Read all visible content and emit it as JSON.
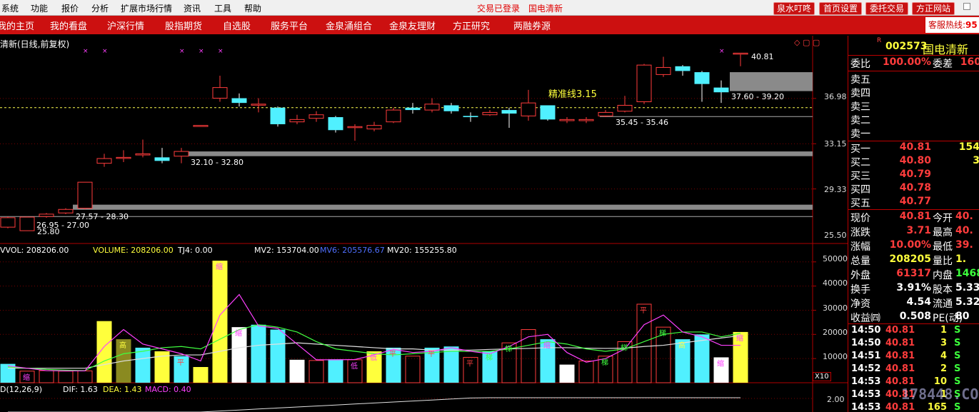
{
  "menubar": {
    "items": [
      "系统",
      "功能",
      "报价",
      "分析",
      "扩展市场行情",
      "资讯",
      "工具",
      "帮助"
    ],
    "status_login": "交易已登录",
    "status_stock": "国电清新",
    "buttons": [
      "泉水叮咚",
      "首页设置",
      "委托交易",
      "方正网站"
    ]
  },
  "navbar": {
    "items": [
      "我的主页",
      "我的看盘",
      "沪深行情",
      "股指期货",
      "自选股",
      "服务平台",
      "金泉涌组合",
      "金泉友理财",
      "方正研究",
      "两融券源"
    ],
    "hotline_label": "客服热线:",
    "hotline_number": "95"
  },
  "kline": {
    "title": "清新(日线,前复权)",
    "price_axis": [
      "36.98",
      "33.15",
      "29.33",
      "25.50"
    ],
    "benchmark_label": "精准线3.15",
    "high_label": "40.81",
    "low_label": "25.80",
    "zones": [
      "37.60 - 39.20",
      "35.45 - 35.46",
      "32.10 - 32.80",
      "27.57 - 28.30",
      "26.95 - 27.00"
    ]
  },
  "volume": {
    "header": {
      "vol": "VVOL: 208206.00",
      "volume": "VOLUME: 208206.00",
      "tj4": "TJ4: 0.00",
      "mv2": "MV2: 153704.00",
      "mv6": "MV6: 205576.67",
      "mv20": "MV20: 155255.80"
    },
    "axis": [
      "50000",
      "40000",
      "30000",
      "20000",
      "10000"
    ],
    "unit": "X10",
    "marks": [
      "高",
      "缩",
      "高",
      "缩",
      "平",
      "缩",
      "低",
      "平",
      "低",
      "平",
      "平",
      "梯",
      "梯",
      "缩",
      "梯",
      "梯",
      "平",
      "梯",
      "高",
      "缩",
      "缩"
    ]
  },
  "macd": {
    "header": {
      "name": "D(12,26,9)",
      "dif": "DIF: 1.63",
      "dea": "DEA: 1.43",
      "macd": "MACD: 0.40"
    },
    "axis": [
      "2.00"
    ]
  },
  "quote": {
    "code": "002573",
    "name": "国电清新",
    "wb_label": "委比",
    "wb_value": "100.00%",
    "wc_label": "委差",
    "wc_value": "160",
    "asks": [
      "卖五",
      "卖四",
      "卖三",
      "卖二",
      "卖一"
    ],
    "bids": [
      {
        "label": "买一",
        "price": "40.81",
        "vol": "154"
      },
      {
        "label": "买二",
        "price": "40.80",
        "vol": "3"
      },
      {
        "label": "买三",
        "price": "40.79",
        "vol": ""
      },
      {
        "label": "买四",
        "price": "40.78",
        "vol": ""
      },
      {
        "label": "买五",
        "price": "40.77",
        "vol": ""
      }
    ],
    "stats": [
      {
        "l1": "现价",
        "v1": "40.81",
        "c1": "red",
        "l2": "今开",
        "v2": "40.",
        "c2": "red"
      },
      {
        "l1": "涨跌",
        "v1": "3.71",
        "c1": "red",
        "l2": "最高",
        "v2": "40.",
        "c2": "red"
      },
      {
        "l1": "涨幅",
        "v1": "10.00%",
        "c1": "red",
        "l2": "最低",
        "v2": "39.",
        "c2": "red"
      },
      {
        "l1": "总量",
        "v1": "208205",
        "c1": "yellow",
        "l2": "量比",
        "v2": "1.",
        "c2": "yellow"
      },
      {
        "l1": "外盘",
        "v1": "61317",
        "c1": "red",
        "l2": "内盘",
        "v2": "1468",
        "c2": "green"
      },
      {
        "l1": "换手",
        "v1": "3.91%",
        "c1": "white",
        "l2": "股本",
        "v2": "5.33",
        "c2": "white"
      },
      {
        "l1": "净资",
        "v1": "4.54",
        "c1": "white",
        "l2": "流通",
        "v2": "5.32",
        "c2": "white"
      },
      {
        "l1": "收益㈣",
        "v1": "0.508",
        "c1": "white",
        "l2": "PE(动)",
        "v2": "80",
        "c2": "white"
      }
    ],
    "ticks": [
      {
        "time": "14:50",
        "price": "40.81",
        "vol": "1",
        "side": "S"
      },
      {
        "time": "14:50",
        "price": "40.81",
        "vol": "3",
        "side": "S"
      },
      {
        "time": "14:51",
        "price": "40.81",
        "vol": "4",
        "side": "S"
      },
      {
        "time": "14:52",
        "price": "40.81",
        "vol": "2",
        "side": "S"
      },
      {
        "time": "14:53",
        "price": "40.81",
        "vol": "10",
        "side": "S"
      },
      {
        "time": "14:53",
        "price": "40.81",
        "vol": "1",
        "side": "S"
      },
      {
        "time": "14:53",
        "price": "40.81",
        "vol": "165",
        "side": "S"
      }
    ]
  },
  "watermark": "178448.COM",
  "chart_data": {
    "type": "candlestick",
    "title": "清新(日线,前复权)",
    "ylim": [
      24.9,
      41.8
    ],
    "candles": [
      {
        "o": 26.1,
        "c": 26.9,
        "h": 27.0,
        "l": 26.0
      },
      {
        "o": 25.8,
        "c": 26.95,
        "h": 27.0,
        "l": 25.8
      },
      {
        "o": 27.0,
        "c": 27.2,
        "h": 27.3,
        "l": 26.9
      },
      {
        "o": 27.3,
        "c": 27.6,
        "h": 27.7,
        "l": 27.2
      },
      {
        "o": 27.7,
        "c": 29.9,
        "h": 29.9,
        "l": 27.6
      },
      {
        "o": 31.5,
        "c": 31.9,
        "h": 32.3,
        "l": 31.2
      },
      {
        "o": 32.0,
        "c": 32.0,
        "h": 32.6,
        "l": 31.6
      },
      {
        "o": 32.2,
        "c": 32.3,
        "h": 33.5,
        "l": 32.0
      },
      {
        "o": 32.0,
        "c": 31.7,
        "h": 32.8,
        "l": 31.5
      },
      {
        "o": 32.1,
        "c": 32.5,
        "h": 32.8,
        "l": 31.5
      },
      {
        "o": 34.7,
        "c": 34.7,
        "h": 34.7,
        "l": 34.7
      },
      {
        "o": 37.0,
        "c": 37.9,
        "h": 38.9,
        "l": 36.7
      },
      {
        "o": 37.0,
        "c": 36.6,
        "h": 37.4,
        "l": 36.3
      },
      {
        "o": 36.5,
        "c": 36.5,
        "h": 37.0,
        "l": 35.8
      },
      {
        "o": 36.2,
        "c": 34.8,
        "h": 36.3,
        "l": 34.6
      },
      {
        "o": 35.0,
        "c": 35.2,
        "h": 35.6,
        "l": 34.8
      },
      {
        "o": 35.3,
        "c": 35.6,
        "h": 35.9,
        "l": 35.0
      },
      {
        "o": 35.4,
        "c": 34.3,
        "h": 35.5,
        "l": 34.1
      },
      {
        "o": 34.6,
        "c": 34.6,
        "h": 34.8,
        "l": 33.4
      },
      {
        "o": 34.4,
        "c": 34.7,
        "h": 35.0,
        "l": 34.2
      },
      {
        "o": 35.0,
        "c": 36.0,
        "h": 36.2,
        "l": 34.9
      },
      {
        "o": 36.2,
        "c": 36.0,
        "h": 36.6,
        "l": 35.7
      },
      {
        "o": 36.0,
        "c": 36.5,
        "h": 37.0,
        "l": 35.8
      },
      {
        "o": 36.4,
        "c": 35.9,
        "h": 36.6,
        "l": 35.7
      },
      {
        "o": 35.5,
        "c": 35.4,
        "h": 35.8,
        "l": 35.0
      },
      {
        "o": 35.6,
        "c": 35.8,
        "h": 36.0,
        "l": 35.5
      },
      {
        "o": 36.0,
        "c": 35.7,
        "h": 36.2,
        "l": 34.5
      },
      {
        "o": 35.5,
        "c": 36.6,
        "h": 37.7,
        "l": 35.1
      },
      {
        "o": 36.4,
        "c": 35.2,
        "h": 36.4,
        "l": 35.1
      },
      {
        "o": 35.1,
        "c": 35.2,
        "h": 35.4,
        "l": 34.9
      },
      {
        "o": 35.1,
        "c": 35.2,
        "h": 35.4,
        "l": 34.9
      },
      {
        "o": 35.5,
        "c": 35.8,
        "h": 36.0,
        "l": 35.4
      },
      {
        "o": 35.9,
        "c": 36.4,
        "h": 37.2,
        "l": 35.8
      },
      {
        "o": 36.7,
        "c": 39.8,
        "h": 39.9,
        "l": 36.5
      },
      {
        "o": 39.0,
        "c": 39.6,
        "h": 40.5,
        "l": 38.8
      },
      {
        "o": 39.7,
        "c": 39.3,
        "h": 39.8,
        "l": 38.9
      },
      {
        "o": 39.2,
        "c": 38.2,
        "h": 39.3,
        "l": 36.7
      },
      {
        "o": 37.9,
        "c": 37.5,
        "h": 38.5,
        "l": 36.6
      },
      {
        "o": 40.81,
        "c": 40.81,
        "h": 40.81,
        "l": 39.7
      }
    ],
    "volume": {
      "ylim": [
        0,
        52000
      ],
      "values": [
        7800,
        4800,
        5000,
        4800,
        4900,
        25500,
        18000,
        14500,
        13000,
        11000,
        6500,
        50500,
        23000,
        24000,
        22000,
        9500,
        9200,
        9700,
        9500,
        13000,
        14500,
        11000,
        14500,
        15000,
        10500,
        13000,
        16500,
        22000,
        18000,
        7500,
        9000,
        11000,
        17000,
        32500,
        23000,
        18000,
        20000,
        10500,
        21000
      ],
      "colors": [
        "cyan",
        "red",
        "red",
        "red",
        "red",
        "yellow",
        "olive",
        "cyan",
        "yellow",
        "cyan",
        "yellow",
        "yellow",
        "white",
        "cyan",
        "cyan",
        "white",
        "red",
        "cyan",
        "red",
        "yellow",
        "cyan",
        "red",
        "cyan",
        "cyan",
        "red",
        "cyan",
        "red",
        "red",
        "cyan",
        "white",
        "red",
        "red",
        "red",
        "red",
        "red",
        "cyan",
        "cyan",
        "white",
        "yellow"
      ],
      "mv2": [
        7000,
        6000,
        5000,
        4900,
        4900,
        15000,
        22000,
        16000,
        14000,
        12000,
        9000,
        28000,
        36500,
        23500,
        22500,
        16000,
        9500,
        9500,
        9600,
        11500,
        13800,
        12500,
        13000,
        14500,
        13000,
        12000,
        15000,
        19000,
        20000,
        12500,
        8500,
        10000,
        14000,
        24000,
        28000,
        21000,
        19000,
        15500,
        15500
      ],
      "mv6": [
        6500,
        6000,
        5500,
        5200,
        5000,
        9000,
        12000,
        13000,
        14500,
        15000,
        14000,
        18000,
        22000,
        24000,
        23000,
        21000,
        17000,
        14000,
        13000,
        12000,
        11500,
        12000,
        12500,
        13000,
        13000,
        13000,
        14000,
        15500,
        17000,
        16000,
        14000,
        13000,
        14000,
        17000,
        20000,
        21000,
        21000,
        19000,
        20500
      ],
      "mv20": [
        6000,
        6000,
        6000,
        6000,
        6000,
        7500,
        9000,
        10000,
        11000,
        11500,
        11500,
        13000,
        14500,
        15500,
        16000,
        16500,
        16000,
        15500,
        15000,
        14500,
        14000,
        14000,
        13500,
        13500,
        13500,
        13800,
        14000,
        14200,
        14500,
        14500,
        14300,
        14200,
        14300,
        15000,
        15500,
        16500,
        17500,
        18500,
        19500
      ]
    },
    "macd": {
      "dif": 1.63,
      "dea": 1.43,
      "macd": 0.4
    }
  }
}
